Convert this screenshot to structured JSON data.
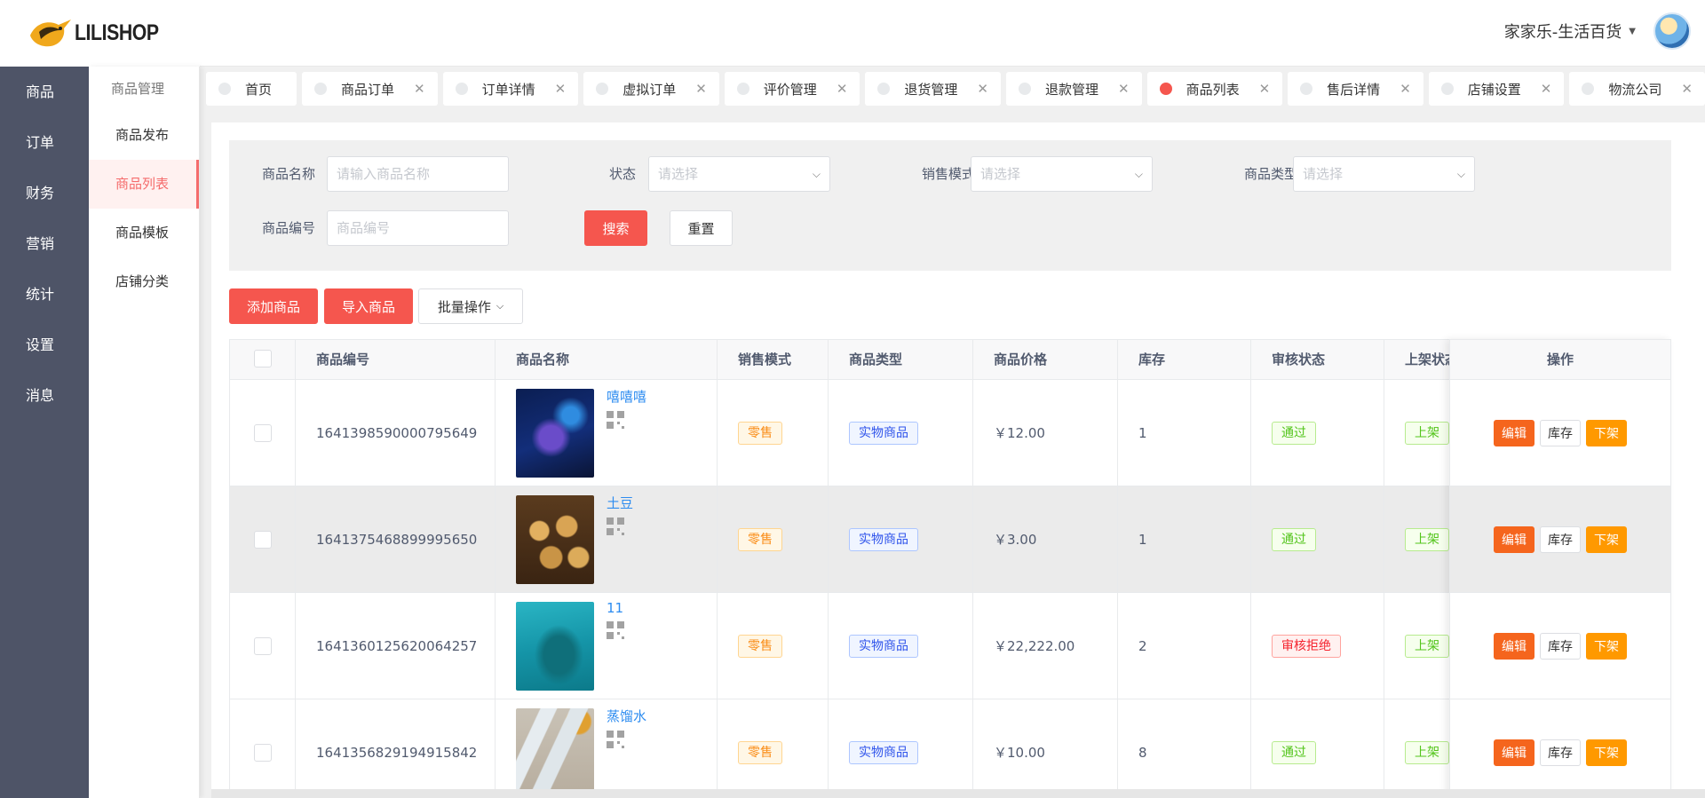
{
  "brand": {
    "logo_text": "LILISHOP"
  },
  "user": {
    "shop_name": "家家乐-生活百货"
  },
  "rail": [
    "商品",
    "订单",
    "财务",
    "营销",
    "统计",
    "设置",
    "消息"
  ],
  "submenu": {
    "head": "商品管理",
    "items": [
      "商品发布",
      "商品列表",
      "商品模板",
      "店铺分类"
    ],
    "active_index": 1
  },
  "tabs": [
    {
      "label": "首页",
      "closable": false,
      "active": false
    },
    {
      "label": "商品订单",
      "closable": true,
      "active": false
    },
    {
      "label": "订单详情",
      "closable": true,
      "active": false
    },
    {
      "label": "虚拟订单",
      "closable": true,
      "active": false
    },
    {
      "label": "评价管理",
      "closable": true,
      "active": false
    },
    {
      "label": "退货管理",
      "closable": true,
      "active": false
    },
    {
      "label": "退款管理",
      "closable": true,
      "active": false
    },
    {
      "label": "商品列表",
      "closable": true,
      "active": true
    },
    {
      "label": "售后详情",
      "closable": true,
      "active": false
    },
    {
      "label": "店铺设置",
      "closable": true,
      "active": false
    },
    {
      "label": "物流公司",
      "closable": true,
      "active": false
    }
  ],
  "filter": {
    "name_label": "商品名称",
    "name_placeholder": "请输入商品名称",
    "status_label": "状态",
    "status_placeholder": "请选择",
    "mode_label": "销售模式",
    "mode_placeholder": "请选择",
    "type_label": "商品类型",
    "type_placeholder": "请选择",
    "sn_label": "商品编号",
    "sn_placeholder": "商品编号",
    "search_btn": "搜索",
    "reset_btn": "重置"
  },
  "actions": {
    "add": "添加商品",
    "import": "导入商品",
    "batch": "批量操作"
  },
  "table": {
    "headers": [
      "商品编号",
      "商品名称",
      "销售模式",
      "商品类型",
      "商品价格",
      "库存",
      "审核状态",
      "上架状态",
      "操作"
    ],
    "op_labels": {
      "edit": "编辑",
      "stock": "库存",
      "down": "下架"
    },
    "rows": [
      {
        "sn": "1641398590000795649",
        "name": "嘻嘻嘻",
        "mode": "零售",
        "type": "实物商品",
        "price": "￥12.00",
        "stock": "1",
        "audit": "通过",
        "audit_ok": true,
        "shelf": "上架"
      },
      {
        "sn": "1641375468899995650",
        "name": "土豆",
        "mode": "零售",
        "type": "实物商品",
        "price": "￥3.00",
        "stock": "1",
        "audit": "通过",
        "audit_ok": true,
        "shelf": "上架"
      },
      {
        "sn": "1641360125620064257",
        "name": "11",
        "mode": "零售",
        "type": "实物商品",
        "price": "￥22,222.00",
        "stock": "2",
        "audit": "审核拒绝",
        "audit_ok": false,
        "shelf": "上架"
      },
      {
        "sn": "1641356829194915842",
        "name": "蒸馏水",
        "mode": "零售",
        "type": "实物商品",
        "price": "￥10.00",
        "stock": "8",
        "audit": "通过",
        "audit_ok": true,
        "shelf": "上架"
      }
    ]
  },
  "colors": {
    "primary": "#f5564e",
    "edit": "#f5651d",
    "down": "#ff9900",
    "rail": "#4e5467"
  }
}
